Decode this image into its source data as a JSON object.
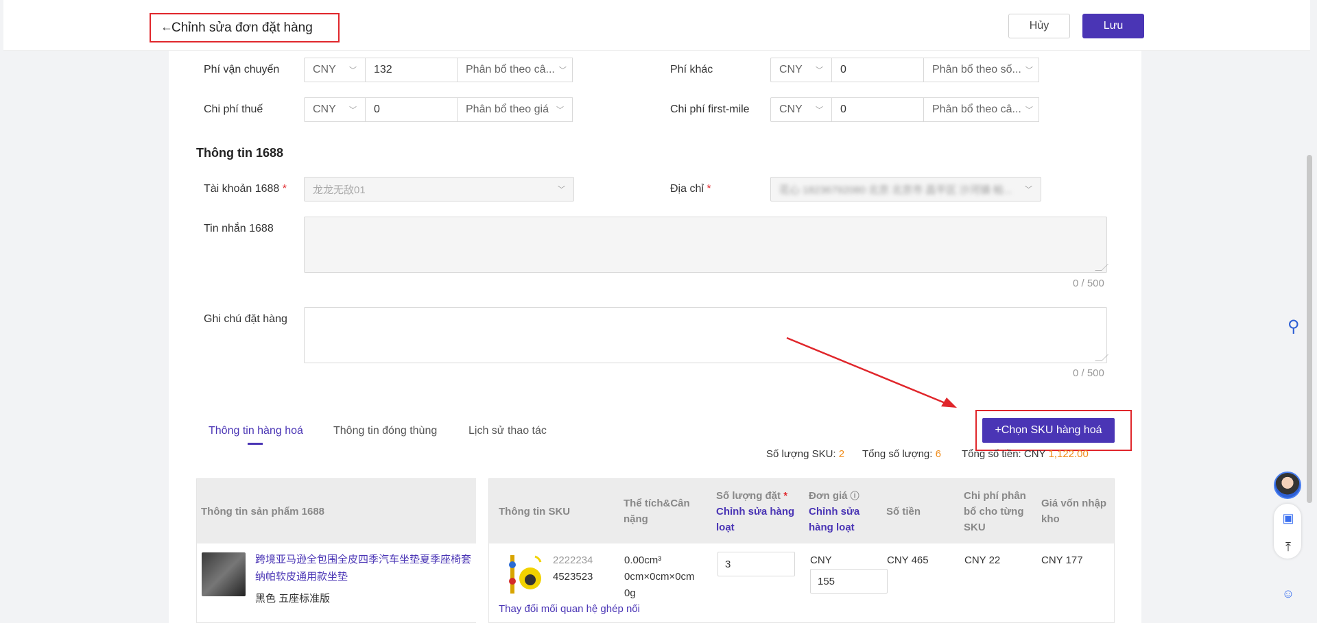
{
  "header": {
    "title": "Chỉnh sửa đơn đặt hàng",
    "cancel_label": "Hủy",
    "save_label": "Lưu"
  },
  "fees": {
    "shipping": {
      "label": "Phí vận chuyển",
      "currency": "CNY",
      "value": "132",
      "allocation": "Phân bổ theo câ..."
    },
    "other": {
      "label": "Phí khác",
      "currency": "CNY",
      "value": "0",
      "allocation": "Phân bổ theo số..."
    },
    "tax": {
      "label": "Chi phí thuế",
      "currency": "CNY",
      "value": "0",
      "allocation": "Phân bổ theo giá"
    },
    "first_mile": {
      "label": "Chi phí first-mile",
      "currency": "CNY",
      "value": "0",
      "allocation": "Phân bổ theo câ..."
    }
  },
  "info1688": {
    "section_title": "Thông tin 1688",
    "account_label": "Tài khoản 1688",
    "account_value": "龙龙无敌01",
    "address_label": "Địa chỉ",
    "address_value": "花心 18236792080 北京 北京市 昌平区 沙河镇 帕...",
    "message_label": "Tin nhắn 1688",
    "message_counter": "0 / 500",
    "note_label": "Ghi chú đặt hàng",
    "note_counter": "0 / 500"
  },
  "tabs": [
    {
      "label": "Thông tin hàng hoá",
      "active": true
    },
    {
      "label": "Thông tin đóng thùng",
      "active": false
    },
    {
      "label": "Lịch sử thao tác",
      "active": false
    }
  ],
  "choose_sku_label": "+Chọn SKU hàng hoá",
  "stats": {
    "sku_count_label": "Số lượng SKU:",
    "sku_count": "2",
    "total_qty_label": "Tổng số lượng:",
    "total_qty": "6",
    "total_amount_label": "Tổng số tiền:",
    "total_currency": "CNY",
    "total_amount": "1,122.00"
  },
  "table": {
    "left_header": "Thông tin sản phẩm 1688",
    "headers": {
      "sku_info": "Thông tin SKU",
      "volume_weight": "Thể tích&Cân nặng",
      "order_qty": "Số lượng đặt",
      "order_qty_bulk": "Chỉnh sửa hàng loạt",
      "unit_price": "Đơn giá",
      "unit_price_bulk": "Chỉnh sửa hàng loạt",
      "amount": "Số tiền",
      "allocated_cost": "Chi phí phân bổ cho từng SKU",
      "landed_cost": "Giá vốn nhập kho"
    },
    "rows": [
      {
        "product_title": "跨境亚马逊全包围全皮四季汽车坐垫夏季座椅套纳帕软皮通用款坐垫",
        "product_variant": "黑色 五座标准版",
        "sku_code_1": "2222234",
        "sku_code_2": "4523523",
        "volume": "0.00cm³",
        "dimensions": "0cm×0cm×0cm",
        "weight": "0g",
        "qty": "3",
        "price_currency": "CNY",
        "price": "155",
        "amount": "CNY 465",
        "allocated": "CNY 22",
        "landed": "CNY 177",
        "change_link": "Thay đổi mối quan hệ ghép nối"
      }
    ]
  },
  "colors": {
    "primary": "#4a35b5",
    "highlight_red": "#e0262b",
    "accent_orange": "#f08c1a"
  }
}
